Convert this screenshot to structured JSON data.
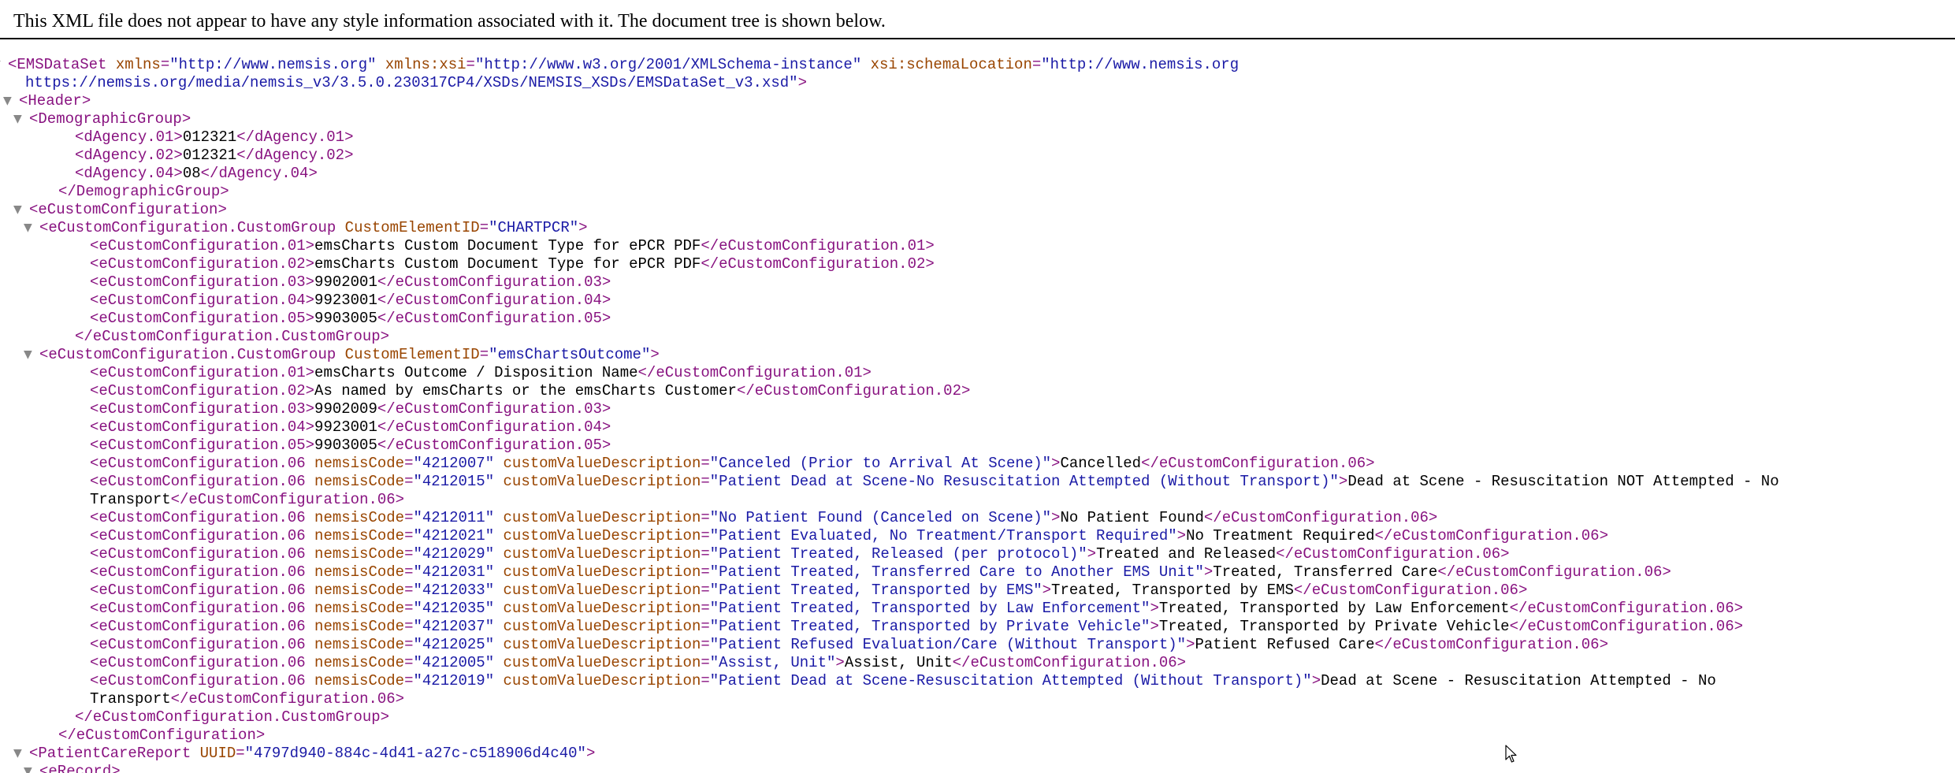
{
  "window": {
    "notice": "This XML file does not appear to have any style information associated with it. The document tree is shown below."
  },
  "icons": {
    "expanded": "triangle-down-icon",
    "cursor": "mouse-pointer-icon"
  },
  "colors": {
    "tag": "#881280",
    "attribute": "#994500",
    "value": "#1a1aa6",
    "text": "#000000"
  },
  "lines": [
    {
      "toggle": true,
      "parts": [
        {
          "c": "tag",
          "t": "<EMSDataSet "
        },
        {
          "c": "attr",
          "t": "xmlns"
        },
        {
          "c": "tag",
          "t": "="
        },
        {
          "c": "val",
          "t": "\"http://www.nemsis.org\""
        },
        {
          "c": "attr",
          "t": " xmlns:xsi"
        },
        {
          "c": "tag",
          "t": "="
        },
        {
          "c": "val",
          "t": "\"http://www.w3.org/2001/XMLSchema-instance\""
        },
        {
          "c": "attr",
          "t": " xsi:schemaLocation"
        },
        {
          "c": "tag",
          "t": "="
        },
        {
          "c": "val",
          "t": "\"http://www.nemsis.org"
        }
      ]
    },
    {
      "toggle": false,
      "parts": [
        {
          "c": "val",
          "t": "https://nemsis.org/media/nemsis_v3/3.5.0.230317CP4/XSDs/NEMSIS_XSDs/EMSDataSet_v3.xsd\""
        },
        {
          "c": "tag",
          "t": ">"
        }
      ]
    },
    {
      "toggle": true,
      "parts": [
        {
          "c": "tag",
          "t": "<Header>"
        }
      ]
    },
    {
      "toggle": true,
      "parts": [
        {
          "c": "tag",
          "t": "<DemographicGroup>"
        }
      ]
    },
    {
      "toggle": false,
      "parts": [
        {
          "c": "tag",
          "t": "<dAgency.01>"
        },
        {
          "c": "txt",
          "t": "012321"
        },
        {
          "c": "tag",
          "t": "</dAgency.01>"
        }
      ]
    },
    {
      "toggle": false,
      "parts": [
        {
          "c": "tag",
          "t": "<dAgency.02>"
        },
        {
          "c": "txt",
          "t": "012321"
        },
        {
          "c": "tag",
          "t": "</dAgency.02>"
        }
      ]
    },
    {
      "toggle": false,
      "parts": [
        {
          "c": "tag",
          "t": "<dAgency.04>"
        },
        {
          "c": "txt",
          "t": "08"
        },
        {
          "c": "tag",
          "t": "</dAgency.04>"
        }
      ]
    },
    {
      "toggle": false,
      "parts": [
        {
          "c": "tag",
          "t": "</DemographicGroup>"
        }
      ]
    },
    {
      "toggle": true,
      "parts": [
        {
          "c": "tag",
          "t": "<eCustomConfiguration>"
        }
      ]
    },
    {
      "toggle": true,
      "parts": [
        {
          "c": "tag",
          "t": "<eCustomConfiguration.CustomGroup "
        },
        {
          "c": "attr",
          "t": "CustomElementID"
        },
        {
          "c": "tag",
          "t": "="
        },
        {
          "c": "val",
          "t": "\"CHARTPCR\""
        },
        {
          "c": "tag",
          "t": ">"
        }
      ]
    },
    {
      "toggle": false,
      "parts": [
        {
          "c": "tag",
          "t": "<eCustomConfiguration.01>"
        },
        {
          "c": "txt",
          "t": "emsCharts Custom Document Type for ePCR PDF"
        },
        {
          "c": "tag",
          "t": "</eCustomConfiguration.01>"
        }
      ]
    },
    {
      "toggle": false,
      "parts": [
        {
          "c": "tag",
          "t": "<eCustomConfiguration.02>"
        },
        {
          "c": "txt",
          "t": "emsCharts Custom Document Type for ePCR PDF"
        },
        {
          "c": "tag",
          "t": "</eCustomConfiguration.02>"
        }
      ]
    },
    {
      "toggle": false,
      "parts": [
        {
          "c": "tag",
          "t": "<eCustomConfiguration.03>"
        },
        {
          "c": "txt",
          "t": "9902001"
        },
        {
          "c": "tag",
          "t": "</eCustomConfiguration.03>"
        }
      ]
    },
    {
      "toggle": false,
      "parts": [
        {
          "c": "tag",
          "t": "<eCustomConfiguration.04>"
        },
        {
          "c": "txt",
          "t": "9923001"
        },
        {
          "c": "tag",
          "t": "</eCustomConfiguration.04>"
        }
      ]
    },
    {
      "toggle": false,
      "parts": [
        {
          "c": "tag",
          "t": "<eCustomConfiguration.05>"
        },
        {
          "c": "txt",
          "t": "9903005"
        },
        {
          "c": "tag",
          "t": "</eCustomConfiguration.05>"
        }
      ]
    },
    {
      "toggle": false,
      "parts": [
        {
          "c": "tag",
          "t": "</eCustomConfiguration.CustomGroup>"
        }
      ]
    },
    {
      "toggle": true,
      "parts": [
        {
          "c": "tag",
          "t": "<eCustomConfiguration.CustomGroup "
        },
        {
          "c": "attr",
          "t": "CustomElementID"
        },
        {
          "c": "tag",
          "t": "="
        },
        {
          "c": "val",
          "t": "\"emsChartsOutcome\""
        },
        {
          "c": "tag",
          "t": ">"
        }
      ]
    },
    {
      "toggle": false,
      "parts": [
        {
          "c": "tag",
          "t": "<eCustomConfiguration.01>"
        },
        {
          "c": "txt",
          "t": "emsCharts Outcome / Disposition Name"
        },
        {
          "c": "tag",
          "t": "</eCustomConfiguration.01>"
        }
      ]
    },
    {
      "toggle": false,
      "parts": [
        {
          "c": "tag",
          "t": "<eCustomConfiguration.02>"
        },
        {
          "c": "txt",
          "t": "As named by emsCharts or the emsCharts Customer"
        },
        {
          "c": "tag",
          "t": "</eCustomConfiguration.02>"
        }
      ]
    },
    {
      "toggle": false,
      "parts": [
        {
          "c": "tag",
          "t": "<eCustomConfiguration.03>"
        },
        {
          "c": "txt",
          "t": "9902009"
        },
        {
          "c": "tag",
          "t": "</eCustomConfiguration.03>"
        }
      ]
    },
    {
      "toggle": false,
      "parts": [
        {
          "c": "tag",
          "t": "<eCustomConfiguration.04>"
        },
        {
          "c": "txt",
          "t": "9923001"
        },
        {
          "c": "tag",
          "t": "</eCustomConfiguration.04>"
        }
      ]
    },
    {
      "toggle": false,
      "parts": [
        {
          "c": "tag",
          "t": "<eCustomConfiguration.05>"
        },
        {
          "c": "txt",
          "t": "9903005"
        },
        {
          "c": "tag",
          "t": "</eCustomConfiguration.05>"
        }
      ]
    },
    {
      "toggle": false,
      "parts": [
        {
          "c": "tag",
          "t": "<eCustomConfiguration.06 "
        },
        {
          "c": "attr",
          "t": "nemsisCode"
        },
        {
          "c": "tag",
          "t": "="
        },
        {
          "c": "val",
          "t": "\"4212007\""
        },
        {
          "c": "attr",
          "t": " customValueDescription"
        },
        {
          "c": "tag",
          "t": "="
        },
        {
          "c": "val",
          "t": "\"Canceled (Prior to Arrival At Scene)\""
        },
        {
          "c": "tag",
          "t": ">"
        },
        {
          "c": "txt",
          "t": "Cancelled"
        },
        {
          "c": "tag",
          "t": "</eCustomConfiguration.06>"
        }
      ]
    },
    {
      "toggle": false,
      "parts": [
        {
          "c": "tag",
          "t": "<eCustomConfiguration.06 "
        },
        {
          "c": "attr",
          "t": "nemsisCode"
        },
        {
          "c": "tag",
          "t": "="
        },
        {
          "c": "val",
          "t": "\"4212015\""
        },
        {
          "c": "attr",
          "t": " customValueDescription"
        },
        {
          "c": "tag",
          "t": "="
        },
        {
          "c": "val",
          "t": "\"Patient Dead at Scene-No Resuscitation Attempted (Without Transport)\""
        },
        {
          "c": "tag",
          "t": ">"
        },
        {
          "c": "txt",
          "t": "Dead at Scene - Resuscitation NOT Attempted - No"
        }
      ]
    },
    {
      "toggle": false,
      "parts": [
        {
          "c": "txt",
          "t": "Transport"
        },
        {
          "c": "tag",
          "t": "</eCustomConfiguration.06>"
        }
      ]
    },
    {
      "toggle": false,
      "parts": [
        {
          "c": "tag",
          "t": "<eCustomConfiguration.06 "
        },
        {
          "c": "attr",
          "t": "nemsisCode"
        },
        {
          "c": "tag",
          "t": "="
        },
        {
          "c": "val",
          "t": "\"4212011\""
        },
        {
          "c": "attr",
          "t": " customValueDescription"
        },
        {
          "c": "tag",
          "t": "="
        },
        {
          "c": "val",
          "t": "\"No Patient Found (Canceled on Scene)\""
        },
        {
          "c": "tag",
          "t": ">"
        },
        {
          "c": "txt",
          "t": "No Patient Found"
        },
        {
          "c": "tag",
          "t": "</eCustomConfiguration.06>"
        }
      ]
    },
    {
      "toggle": false,
      "parts": [
        {
          "c": "tag",
          "t": "<eCustomConfiguration.06 "
        },
        {
          "c": "attr",
          "t": "nemsisCode"
        },
        {
          "c": "tag",
          "t": "="
        },
        {
          "c": "val",
          "t": "\"4212021\""
        },
        {
          "c": "attr",
          "t": " customValueDescription"
        },
        {
          "c": "tag",
          "t": "="
        },
        {
          "c": "val",
          "t": "\"Patient Evaluated, No Treatment/Transport Required\""
        },
        {
          "c": "tag",
          "t": ">"
        },
        {
          "c": "txt",
          "t": "No Treatment Required"
        },
        {
          "c": "tag",
          "t": "</eCustomConfiguration.06>"
        }
      ]
    },
    {
      "toggle": false,
      "parts": [
        {
          "c": "tag",
          "t": "<eCustomConfiguration.06 "
        },
        {
          "c": "attr",
          "t": "nemsisCode"
        },
        {
          "c": "tag",
          "t": "="
        },
        {
          "c": "val",
          "t": "\"4212029\""
        },
        {
          "c": "attr",
          "t": " customValueDescription"
        },
        {
          "c": "tag",
          "t": "="
        },
        {
          "c": "val",
          "t": "\"Patient Treated, Released (per protocol)\""
        },
        {
          "c": "tag",
          "t": ">"
        },
        {
          "c": "txt",
          "t": "Treated and Released"
        },
        {
          "c": "tag",
          "t": "</eCustomConfiguration.06>"
        }
      ]
    },
    {
      "toggle": false,
      "parts": [
        {
          "c": "tag",
          "t": "<eCustomConfiguration.06 "
        },
        {
          "c": "attr",
          "t": "nemsisCode"
        },
        {
          "c": "tag",
          "t": "="
        },
        {
          "c": "val",
          "t": "\"4212031\""
        },
        {
          "c": "attr",
          "t": " customValueDescription"
        },
        {
          "c": "tag",
          "t": "="
        },
        {
          "c": "val",
          "t": "\"Patient Treated, Transferred Care to Another EMS Unit\""
        },
        {
          "c": "tag",
          "t": ">"
        },
        {
          "c": "txt",
          "t": "Treated, Transferred Care"
        },
        {
          "c": "tag",
          "t": "</eCustomConfiguration.06>"
        }
      ]
    },
    {
      "toggle": false,
      "parts": [
        {
          "c": "tag",
          "t": "<eCustomConfiguration.06 "
        },
        {
          "c": "attr",
          "t": "nemsisCode"
        },
        {
          "c": "tag",
          "t": "="
        },
        {
          "c": "val",
          "t": "\"4212033\""
        },
        {
          "c": "attr",
          "t": " customValueDescription"
        },
        {
          "c": "tag",
          "t": "="
        },
        {
          "c": "val",
          "t": "\"Patient Treated, Transported by EMS\""
        },
        {
          "c": "tag",
          "t": ">"
        },
        {
          "c": "txt",
          "t": "Treated, Transported by EMS"
        },
        {
          "c": "tag",
          "t": "</eCustomConfiguration.06>"
        }
      ]
    },
    {
      "toggle": false,
      "parts": [
        {
          "c": "tag",
          "t": "<eCustomConfiguration.06 "
        },
        {
          "c": "attr",
          "t": "nemsisCode"
        },
        {
          "c": "tag",
          "t": "="
        },
        {
          "c": "val",
          "t": "\"4212035\""
        },
        {
          "c": "attr",
          "t": " customValueDescription"
        },
        {
          "c": "tag",
          "t": "="
        },
        {
          "c": "val",
          "t": "\"Patient Treated, Transported by Law Enforcement\""
        },
        {
          "c": "tag",
          "t": ">"
        },
        {
          "c": "txt",
          "t": "Treated, Transported by Law Enforcement"
        },
        {
          "c": "tag",
          "t": "</eCustomConfiguration.06>"
        }
      ]
    },
    {
      "toggle": false,
      "parts": [
        {
          "c": "tag",
          "t": "<eCustomConfiguration.06 "
        },
        {
          "c": "attr",
          "t": "nemsisCode"
        },
        {
          "c": "tag",
          "t": "="
        },
        {
          "c": "val",
          "t": "\"4212037\""
        },
        {
          "c": "attr",
          "t": " customValueDescription"
        },
        {
          "c": "tag",
          "t": "="
        },
        {
          "c": "val",
          "t": "\"Patient Treated, Transported by Private Vehicle\""
        },
        {
          "c": "tag",
          "t": ">"
        },
        {
          "c": "txt",
          "t": "Treated, Transported by Private Vehicle"
        },
        {
          "c": "tag",
          "t": "</eCustomConfiguration.06>"
        }
      ]
    },
    {
      "toggle": false,
      "parts": [
        {
          "c": "tag",
          "t": "<eCustomConfiguration.06 "
        },
        {
          "c": "attr",
          "t": "nemsisCode"
        },
        {
          "c": "tag",
          "t": "="
        },
        {
          "c": "val",
          "t": "\"4212025\""
        },
        {
          "c": "attr",
          "t": " customValueDescription"
        },
        {
          "c": "tag",
          "t": "="
        },
        {
          "c": "val",
          "t": "\"Patient Refused Evaluation/Care (Without Transport)\""
        },
        {
          "c": "tag",
          "t": ">"
        },
        {
          "c": "txt",
          "t": "Patient Refused Care"
        },
        {
          "c": "tag",
          "t": "</eCustomConfiguration.06>"
        }
      ]
    },
    {
      "toggle": false,
      "parts": [
        {
          "c": "tag",
          "t": "<eCustomConfiguration.06 "
        },
        {
          "c": "attr",
          "t": "nemsisCode"
        },
        {
          "c": "tag",
          "t": "="
        },
        {
          "c": "val",
          "t": "\"4212005\""
        },
        {
          "c": "attr",
          "t": " customValueDescription"
        },
        {
          "c": "tag",
          "t": "="
        },
        {
          "c": "val",
          "t": "\"Assist, Unit\""
        },
        {
          "c": "tag",
          "t": ">"
        },
        {
          "c": "txt",
          "t": "Assist, Unit"
        },
        {
          "c": "tag",
          "t": "</eCustomConfiguration.06>"
        }
      ]
    },
    {
      "toggle": false,
      "parts": [
        {
          "c": "tag",
          "t": "<eCustomConfiguration.06 "
        },
        {
          "c": "attr",
          "t": "nemsisCode"
        },
        {
          "c": "tag",
          "t": "="
        },
        {
          "c": "val",
          "t": "\"4212019\""
        },
        {
          "c": "attr",
          "t": " customValueDescription"
        },
        {
          "c": "tag",
          "t": "="
        },
        {
          "c": "val",
          "t": "\"Patient Dead at Scene-Resuscitation Attempted (Without Transport)\""
        },
        {
          "c": "tag",
          "t": ">"
        },
        {
          "c": "txt",
          "t": "Dead at Scene - Resuscitation Attempted - No"
        }
      ]
    },
    {
      "toggle": false,
      "parts": [
        {
          "c": "txt",
          "t": "Transport"
        },
        {
          "c": "tag",
          "t": "</eCustomConfiguration.06>"
        }
      ]
    },
    {
      "toggle": false,
      "parts": [
        {
          "c": "tag",
          "t": "</eCustomConfiguration.CustomGroup>"
        }
      ]
    },
    {
      "toggle": false,
      "parts": [
        {
          "c": "tag",
          "t": "</eCustomConfiguration>"
        }
      ]
    },
    {
      "toggle": true,
      "parts": [
        {
          "c": "tag",
          "t": "<PatientCareReport "
        },
        {
          "c": "attr",
          "t": "UUID"
        },
        {
          "c": "tag",
          "t": "="
        },
        {
          "c": "val",
          "t": "\"4797d940-884c-4d41-a27c-c518906d4c40\""
        },
        {
          "c": "tag",
          "t": ">"
        }
      ]
    },
    {
      "toggle": true,
      "parts": [
        {
          "c": "tag",
          "t": "<eRecord>"
        }
      ]
    }
  ]
}
